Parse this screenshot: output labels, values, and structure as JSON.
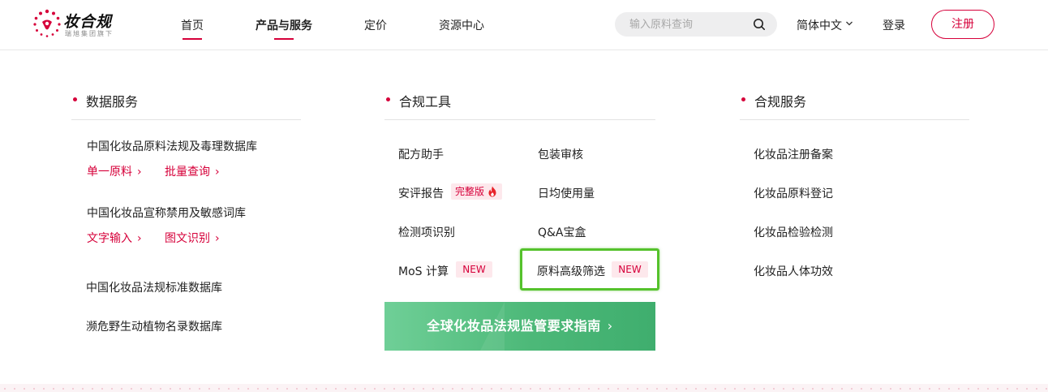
{
  "header": {
    "logo_title": "妆合规",
    "logo_subtitle": "瑞旭集团旗下",
    "nav": [
      {
        "label": "首页",
        "active": true
      },
      {
        "label": "产品与服务",
        "active": true
      },
      {
        "label": "定价",
        "active": false
      },
      {
        "label": "资源中心",
        "active": false
      }
    ],
    "search_placeholder": "输入原料查询",
    "language": "简体中文",
    "login": "登录",
    "register": "注册"
  },
  "data_services": {
    "title": "数据服务",
    "databases": [
      {
        "name": "中国化妆品原料法规及毒理数据库",
        "links": [
          "单一原料",
          "批量查询"
        ]
      },
      {
        "name": "中国化妆品宣称禁用及敏感词库",
        "links": [
          "文字输入",
          "图文识别"
        ]
      },
      {
        "name": "中国化妆品法规标准数据库",
        "links": []
      },
      {
        "name": "濒危野生动植物名录数据库",
        "links": []
      }
    ]
  },
  "compliance_tools": {
    "title": "合规工具",
    "left": [
      {
        "label": "配方助手"
      },
      {
        "label": "安评报告",
        "badge": "完整版",
        "badge_icon": "fire-icon"
      },
      {
        "label": "检测项识别"
      },
      {
        "label": "MoS 计算",
        "badge": "NEW"
      }
    ],
    "right": [
      {
        "label": "包装审核"
      },
      {
        "label": "日均使用量"
      },
      {
        "label": "Q&A宝盒"
      },
      {
        "label": "原料高级筛选",
        "badge": "NEW",
        "highlighted": true
      }
    ],
    "banner": "全球化妆品法规监管要求指南"
  },
  "compliance_services": {
    "title": "合规服务",
    "items": [
      "化妆品注册备案",
      "化妆品原料登记",
      "化妆品检验检测",
      "化妆品人体功效"
    ]
  },
  "colors": {
    "accent": "#d6003a",
    "badge_bg": "#fde8ec",
    "banner_green": "#4cb878",
    "highlight_green": "#55c22c"
  }
}
